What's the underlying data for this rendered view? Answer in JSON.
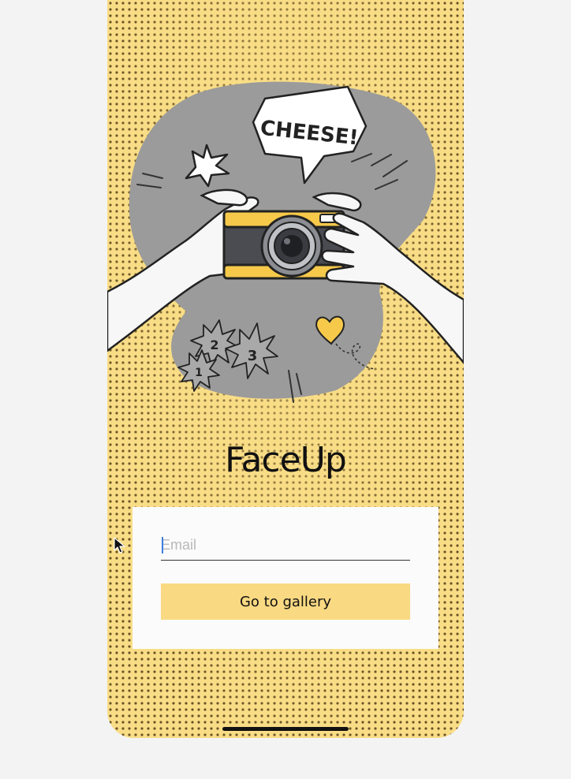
{
  "app": {
    "title": "FaceUp"
  },
  "illustration": {
    "speech_bubble_text": "CHEESE!",
    "burst_numbers": [
      "1",
      "2",
      "3"
    ]
  },
  "login": {
    "email_placeholder": "Email",
    "email_value": "",
    "submit_label": "Go to gallery"
  },
  "colors": {
    "background": "#f9dd86",
    "button": "#f9d982",
    "card": "#fbfbfb",
    "blob": "#9b9b9b",
    "camera_accent": "#f6c94a"
  }
}
